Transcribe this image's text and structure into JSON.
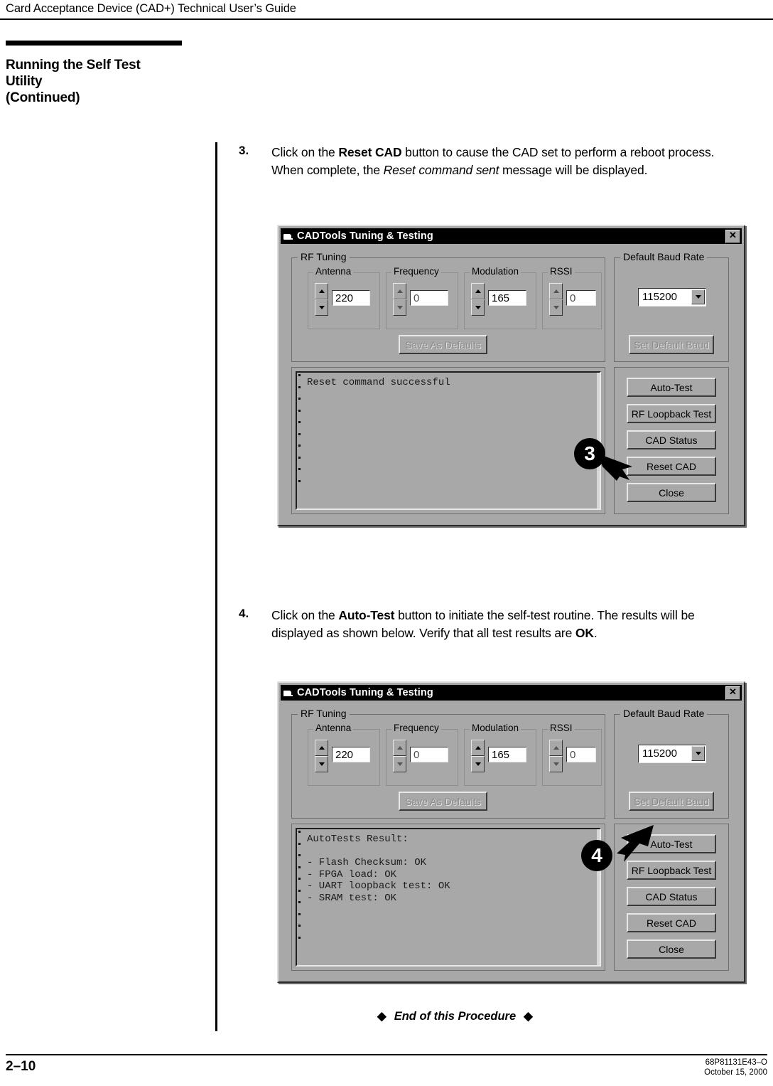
{
  "header": {
    "running_title": "Card Acceptance Device (CAD+) Technical User’s Guide"
  },
  "section": {
    "title_line1": "Running the Self Test",
    "title_line2": "Utility",
    "title_line3": "(Continued)"
  },
  "steps": [
    {
      "number": "3.",
      "text_parts": [
        {
          "text": "Click on the ",
          "style": "normal"
        },
        {
          "text": "Reset CAD",
          "style": "bold"
        },
        {
          "text": " button to cause the CAD set to perform a reboot process. When complete, the ",
          "style": "normal"
        },
        {
          "text": "Reset command sent",
          "style": "italic"
        },
        {
          "text": " message will be displayed.",
          "style": "normal"
        }
      ]
    },
    {
      "number": "4.",
      "text_parts": [
        {
          "text": "Click on the ",
          "style": "normal"
        },
        {
          "text": "Auto-Test",
          "style": "bold"
        },
        {
          "text": " button to initiate the self-test routine. The results will be displayed as shown below. Verify that all test results are ",
          "style": "normal"
        },
        {
          "text": "OK",
          "style": "bold"
        },
        {
          "text": ".",
          "style": "normal"
        }
      ]
    }
  ],
  "dialog": {
    "title": "CADTools Tuning & Testing",
    "close_label": "✕",
    "rf_tuning_legend": "RF Tuning",
    "baud_legend": "Default Baud Rate",
    "fields": {
      "antenna_legend": "Antenna",
      "antenna_value": "220",
      "frequency_legend": "Frequency",
      "frequency_value": "0",
      "modulation_legend": "Modulation",
      "modulation_value": "165",
      "rssi_legend": "RSSI",
      "rssi_value": "0"
    },
    "baud_value": "115200",
    "buttons": {
      "save_defaults": "Save As Defaults",
      "set_default_baud": "Set Default Baud",
      "auto_test": "Auto-Test",
      "rf_loopback_test": "RF Loopback Test",
      "cad_status": "CAD Status",
      "reset_cad": "Reset CAD",
      "close": "Close"
    }
  },
  "screen1": {
    "output_text": "Reset command successful",
    "callout_number": "3"
  },
  "screen2": {
    "output_text": "AutoTests Result:\n\n- Flash Checksum: OK\n- FPGA load: OK\n- UART loopback test: OK\n- SRAM test: OK",
    "callout_number": "4"
  },
  "end_of_procedure": {
    "diamond": "◆",
    "label": "End of this Procedure"
  },
  "footer": {
    "page_number": "2–10",
    "doc_number": "68P81131E43–O",
    "date": "October 15, 2000"
  }
}
